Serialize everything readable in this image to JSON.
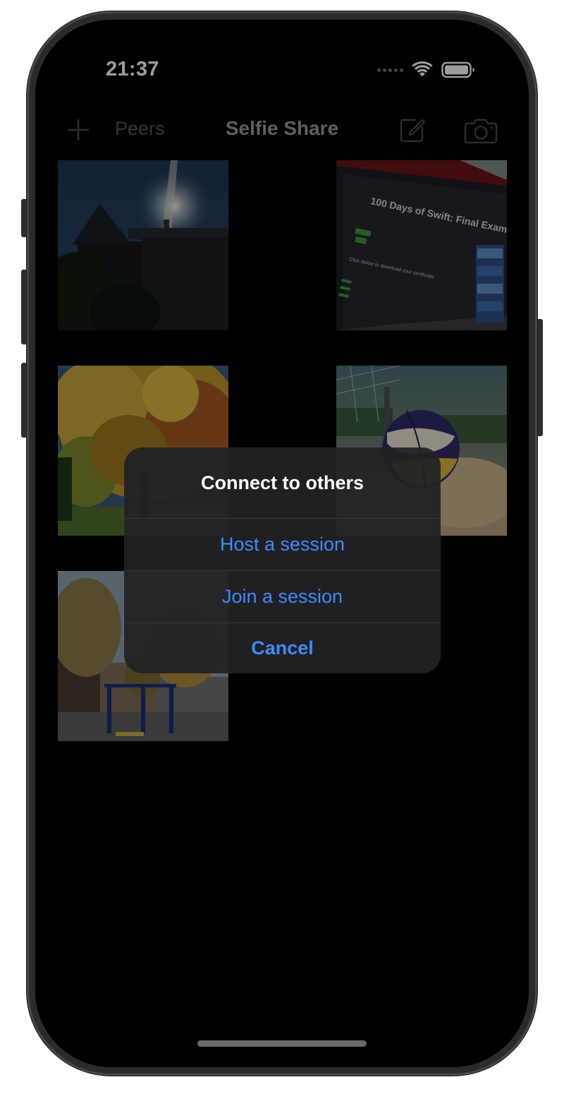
{
  "status_bar": {
    "time": "21:37",
    "icons": [
      "signal-dots-icon",
      "wifi-icon",
      "battery-icon"
    ]
  },
  "navbar": {
    "add_icon": "plus-icon",
    "peers_label": "Peers",
    "title": "Selfie Share",
    "compose_icon": "compose-icon",
    "camera_icon": "camera-icon"
  },
  "photos": [
    {
      "name": "house-with-sun-photo"
    },
    {
      "name": "monitor-final-exam-photo",
      "text_lines": [
        "100 Days of Swift: Final Exam",
        "Click below to download your certificate:"
      ]
    },
    {
      "name": "autumn-tree-photo"
    },
    {
      "name": "volleyball-on-sand-photo"
    },
    {
      "name": "park-playground-photo"
    }
  ],
  "alert": {
    "title": "Connect to others",
    "actions": [
      {
        "label": "Host a session",
        "style": "default"
      },
      {
        "label": "Join a session",
        "style": "default"
      },
      {
        "label": "Cancel",
        "style": "cancel"
      }
    ]
  },
  "colors": {
    "tint": "#3c8cff",
    "background": "#000000",
    "alert_background": "#222224"
  }
}
